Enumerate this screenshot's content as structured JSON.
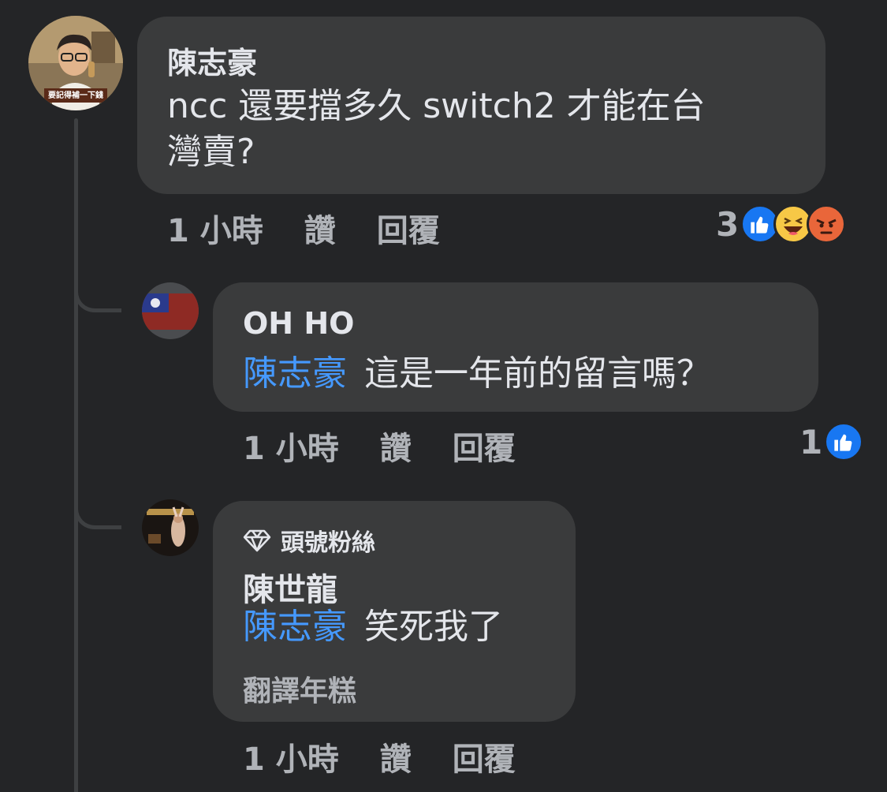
{
  "comments": [
    {
      "author": "陳志豪",
      "text": "ncc 還要擋多久 switch2 才能在台灣賣?",
      "text_line1": "ncc 還要擋多久 switch2 才能在台",
      "text_line2": "灣賣?",
      "avatar_caption": "要記得補一下錢",
      "time": "1 小時",
      "like_label": "讚",
      "reply_label": "回覆",
      "reaction_count": "3",
      "reactions": [
        "like-icon",
        "haha-icon",
        "angry-icon"
      ]
    },
    {
      "author": "OH HO",
      "mention": "陳志豪",
      "text": "這是一年前的留言嗎？",
      "time": "1 小時",
      "like_label": "讚",
      "reply_label": "回覆",
      "reaction_count": "1",
      "reactions": [
        "like-icon"
      ]
    },
    {
      "badge": "頭號粉絲",
      "author": "陳世龍",
      "mention": "陳志豪",
      "text": "笑死我了",
      "translate_label": "翻譯年糕",
      "time": "1 小時",
      "like_label": "讚",
      "reply_label": "回覆"
    }
  ],
  "colors": {
    "background": "#242527",
    "bubble": "#3a3b3c",
    "mention": "#4599ff",
    "secondary_text": "#b0b3b8",
    "like_blue": "#1877f2",
    "haha_yellow": "#f7c846",
    "angry_red": "#e9663a"
  }
}
